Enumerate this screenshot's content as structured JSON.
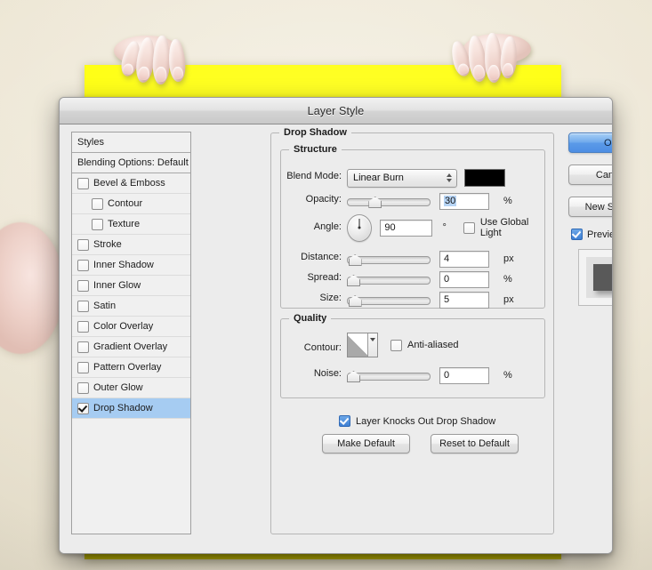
{
  "window": {
    "title": "Layer Style"
  },
  "styles_panel": {
    "items": [
      {
        "label": "Styles",
        "type": "header",
        "checkbox": false,
        "checked": false,
        "selected": false,
        "indent": false
      },
      {
        "label": "Blending Options: Default",
        "type": "header",
        "checkbox": false,
        "checked": false,
        "selected": false,
        "indent": false
      },
      {
        "label": "Bevel & Emboss",
        "type": "effect",
        "checkbox": true,
        "checked": false,
        "selected": false,
        "indent": false
      },
      {
        "label": "Contour",
        "type": "effect",
        "checkbox": true,
        "checked": false,
        "selected": false,
        "indent": true
      },
      {
        "label": "Texture",
        "type": "effect",
        "checkbox": true,
        "checked": false,
        "selected": false,
        "indent": true
      },
      {
        "label": "Stroke",
        "type": "effect",
        "checkbox": true,
        "checked": false,
        "selected": false,
        "indent": false
      },
      {
        "label": "Inner Shadow",
        "type": "effect",
        "checkbox": true,
        "checked": false,
        "selected": false,
        "indent": false
      },
      {
        "label": "Inner Glow",
        "type": "effect",
        "checkbox": true,
        "checked": false,
        "selected": false,
        "indent": false
      },
      {
        "label": "Satin",
        "type": "effect",
        "checkbox": true,
        "checked": false,
        "selected": false,
        "indent": false
      },
      {
        "label": "Color Overlay",
        "type": "effect",
        "checkbox": true,
        "checked": false,
        "selected": false,
        "indent": false
      },
      {
        "label": "Gradient Overlay",
        "type": "effect",
        "checkbox": true,
        "checked": false,
        "selected": false,
        "indent": false
      },
      {
        "label": "Pattern Overlay",
        "type": "effect",
        "checkbox": true,
        "checked": false,
        "selected": false,
        "indent": false
      },
      {
        "label": "Outer Glow",
        "type": "effect",
        "checkbox": true,
        "checked": false,
        "selected": false,
        "indent": false
      },
      {
        "label": "Drop Shadow",
        "type": "effect",
        "checkbox": true,
        "checked": true,
        "selected": true,
        "indent": false
      }
    ]
  },
  "drop_shadow": {
    "legend": "Drop Shadow",
    "structure": {
      "legend": "Structure",
      "blend_mode": {
        "label": "Blend Mode:",
        "value": "Linear Burn",
        "color": "#000000"
      },
      "opacity": {
        "label": "Opacity:",
        "value": "30",
        "unit": "%",
        "percent": 30,
        "selected": true
      },
      "angle": {
        "label": "Angle:",
        "value": "90",
        "unit": "°",
        "degrees": 90,
        "global_light_label": "Use Global Light",
        "global_light_checked": false
      },
      "distance": {
        "label": "Distance:",
        "value": "4",
        "unit": "px",
        "percent": 2
      },
      "spread": {
        "label": "Spread:",
        "value": "0",
        "unit": "%",
        "percent": 0
      },
      "size": {
        "label": "Size:",
        "value": "5",
        "unit": "px",
        "percent": 2
      }
    },
    "quality": {
      "legend": "Quality",
      "contour": {
        "label": "Contour:",
        "anti_aliased_label": "Anti-aliased",
        "anti_aliased_checked": false
      },
      "noise": {
        "label": "Noise:",
        "value": "0",
        "unit": "%",
        "percent": 0
      }
    },
    "knockout": {
      "label": "Layer Knocks Out Drop Shadow",
      "checked": true
    },
    "make_default": "Make Default",
    "reset_default": "Reset to Default"
  },
  "buttons": {
    "ok": "OK",
    "cancel": "Cancel",
    "new_style": "New Style...",
    "preview_label": "Preview",
    "preview_checked": true
  },
  "colors": {
    "selection_blue": "#a6ccf2",
    "default_button_blue": "#5b9ae8",
    "shadow_color": "#000000",
    "canvas_yellow": "#ffff00",
    "backdrop": "#ece5d3"
  }
}
